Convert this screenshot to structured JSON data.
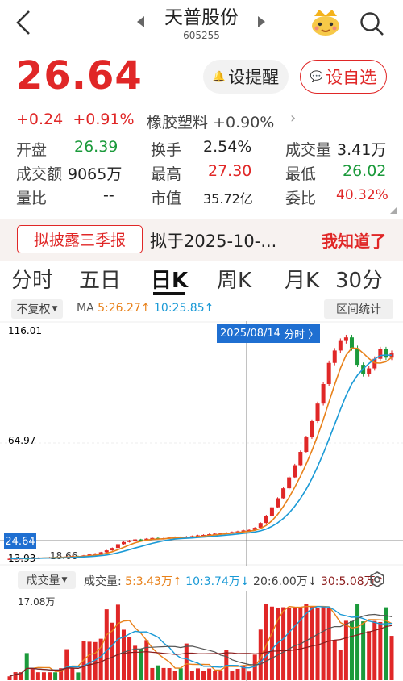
{
  "header": {
    "title": "天普股份",
    "code": "605255"
  },
  "quote": {
    "price": "26.64",
    "change": "+0.24",
    "change_pct": "+0.91%",
    "sector": "橡胶塑料",
    "sector_pct": "+0.90%",
    "remind_label": "设提醒",
    "fav_label": "设自选"
  },
  "stats": {
    "open_label": "开盘",
    "open": "26.39",
    "turnover_label": "换手",
    "turnover": "2.54%",
    "volume_label": "成交量",
    "volume": "3.41万",
    "amount_label": "成交额",
    "amount": "9065万",
    "high_label": "最高",
    "high": "27.30",
    "low_label": "最低",
    "low": "26.02",
    "vol_ratio_label": "量比",
    "vol_ratio": "--",
    "mcap_label": "市值",
    "mcap": "35.72亿",
    "commission_label": "委比",
    "commission": "40.32%"
  },
  "notice": {
    "tag": "拟披露三季报",
    "text": "拟于2025-10-...",
    "ok": "我知道了"
  },
  "tabs": [
    "分时",
    "五日",
    "日K",
    "周K",
    "月K",
    "30分"
  ],
  "ma": {
    "adjust": "不复权",
    "label": "MA",
    "ma5": "5:26.27↑",
    "ma10": "10:25.85↑",
    "range_btn": "区间统计"
  },
  "kchart": {
    "y_top": "116.01",
    "y_mid": "64.97",
    "y_bottom": "13.93",
    "current_tag": "24.64",
    "min_label": "18.66",
    "date_tag": "2025/08/14",
    "date_link": "分时 〉"
  },
  "volume": {
    "selector": "成交量",
    "label": "成交量:",
    "v5": "5:3.43万↑",
    "v10": "10:3.74万↓",
    "v20": "20:6.00万↓",
    "v30": "30:5.08万↑",
    "max_label": "17.08万"
  },
  "colors": {
    "up": "#e02727",
    "down": "#1b9a3b",
    "ma5": "#e8811a",
    "ma10": "#1b9ad6",
    "accent_blue": "#1f6fd1"
  },
  "chart_data": {
    "type": "candlestick",
    "ylim": [
      13.93,
      116.01
    ],
    "yticks": [
      "116.01",
      "64.97",
      "13.93"
    ],
    "ohlc_close": [
      16.5,
      16.6,
      16.7,
      16.6,
      16.8,
      16.9,
      17.0,
      17.1,
      17.0,
      17.2,
      17.4,
      17.6,
      17.5,
      17.9,
      18.3,
      18.7,
      19.2,
      20.0,
      21.0,
      22.6,
      23.5,
      24.2,
      24.6,
      24.3,
      24.9,
      25.2,
      24.8,
      25.1,
      25.4,
      25.6,
      25.3,
      25.8,
      26.0,
      26.3,
      26.5,
      26.8,
      27.0,
      27.2,
      27.5,
      27.7,
      28.0,
      28.4,
      28.6,
      29.5,
      31.5,
      34.6,
      38.1,
      41.9,
      46.1,
      50.7,
      55.8,
      61.4,
      67.5,
      74.3,
      81.7,
      89.9,
      98.8,
      104.0,
      108.0,
      109.5,
      105.0,
      98.0,
      94.0,
      96.5,
      100.5,
      104.5,
      101.0,
      103.0
    ],
    "volume_max_label": "17.08万"
  }
}
